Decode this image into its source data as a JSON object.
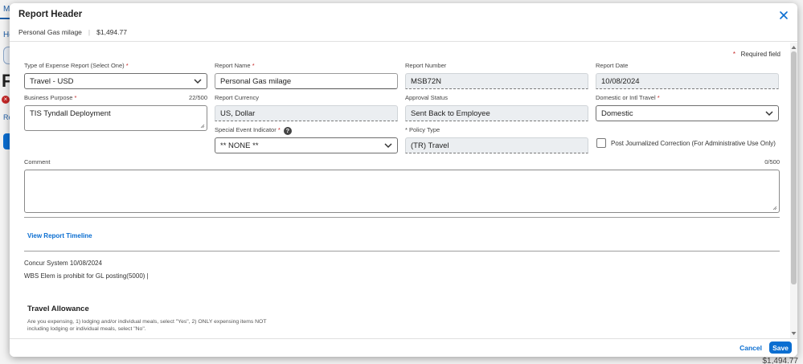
{
  "background": {
    "tab_label": "M",
    "home_link": "Ho",
    "page_letter": "F",
    "error_glyph": "×",
    "report_link": "Re",
    "amount": "$1,494.77"
  },
  "modal": {
    "title": "Report Header",
    "report_name": "Personal Gas milage",
    "report_amount": "$1,494.77",
    "required_note": "Required field",
    "required_star": "*"
  },
  "fields": {
    "expense_type": {
      "label": "Type of Expense Report (Select One)",
      "value": "Travel - USD"
    },
    "report_name": {
      "label": "Report Name",
      "value": "Personal Gas milage"
    },
    "report_number": {
      "label": "Report Number",
      "value": "MSB72N"
    },
    "report_date": {
      "label": "Report Date",
      "value": "10/08/2024"
    },
    "business_purpose": {
      "label": "Business Purpose",
      "counter": "22/500",
      "value": "TIS Tyndall Deployment"
    },
    "report_currency": {
      "label": "Report Currency",
      "value": "US, Dollar"
    },
    "approval_status": {
      "label": "Approval Status",
      "value": "Sent Back to Employee"
    },
    "domestic_intl": {
      "label": "Domestic or Intl Travel",
      "value": "Domestic"
    },
    "special_event": {
      "label": "Special Event Indicator",
      "value": "** NONE **",
      "help_glyph": "?"
    },
    "policy_type": {
      "label": "* Policy Type",
      "value": "(TR) Travel"
    },
    "post_journalized": {
      "label": "Post Journalized Correction (For Administrative Use Only)"
    },
    "comment": {
      "label": "Comment",
      "counter": "0/500",
      "value": ""
    }
  },
  "timeline": {
    "link": "View Report Timeline",
    "system_entry": "Concur System 10/08/2024",
    "message": "WBS Elem is prohibit for GL posting(5000) |"
  },
  "travel_allowance": {
    "title": "Travel Allowance",
    "description": "Are you expensing, 1) lodging and/or individual meals, select \"Yes\", 2) ONLY expensing items NOT including lodging or individual meals, select \"No\"."
  },
  "footer": {
    "cancel_label": "Cancel",
    "save_label": "Save"
  },
  "colors": {
    "accent": "#0a6ed1",
    "required": "#c62828"
  }
}
